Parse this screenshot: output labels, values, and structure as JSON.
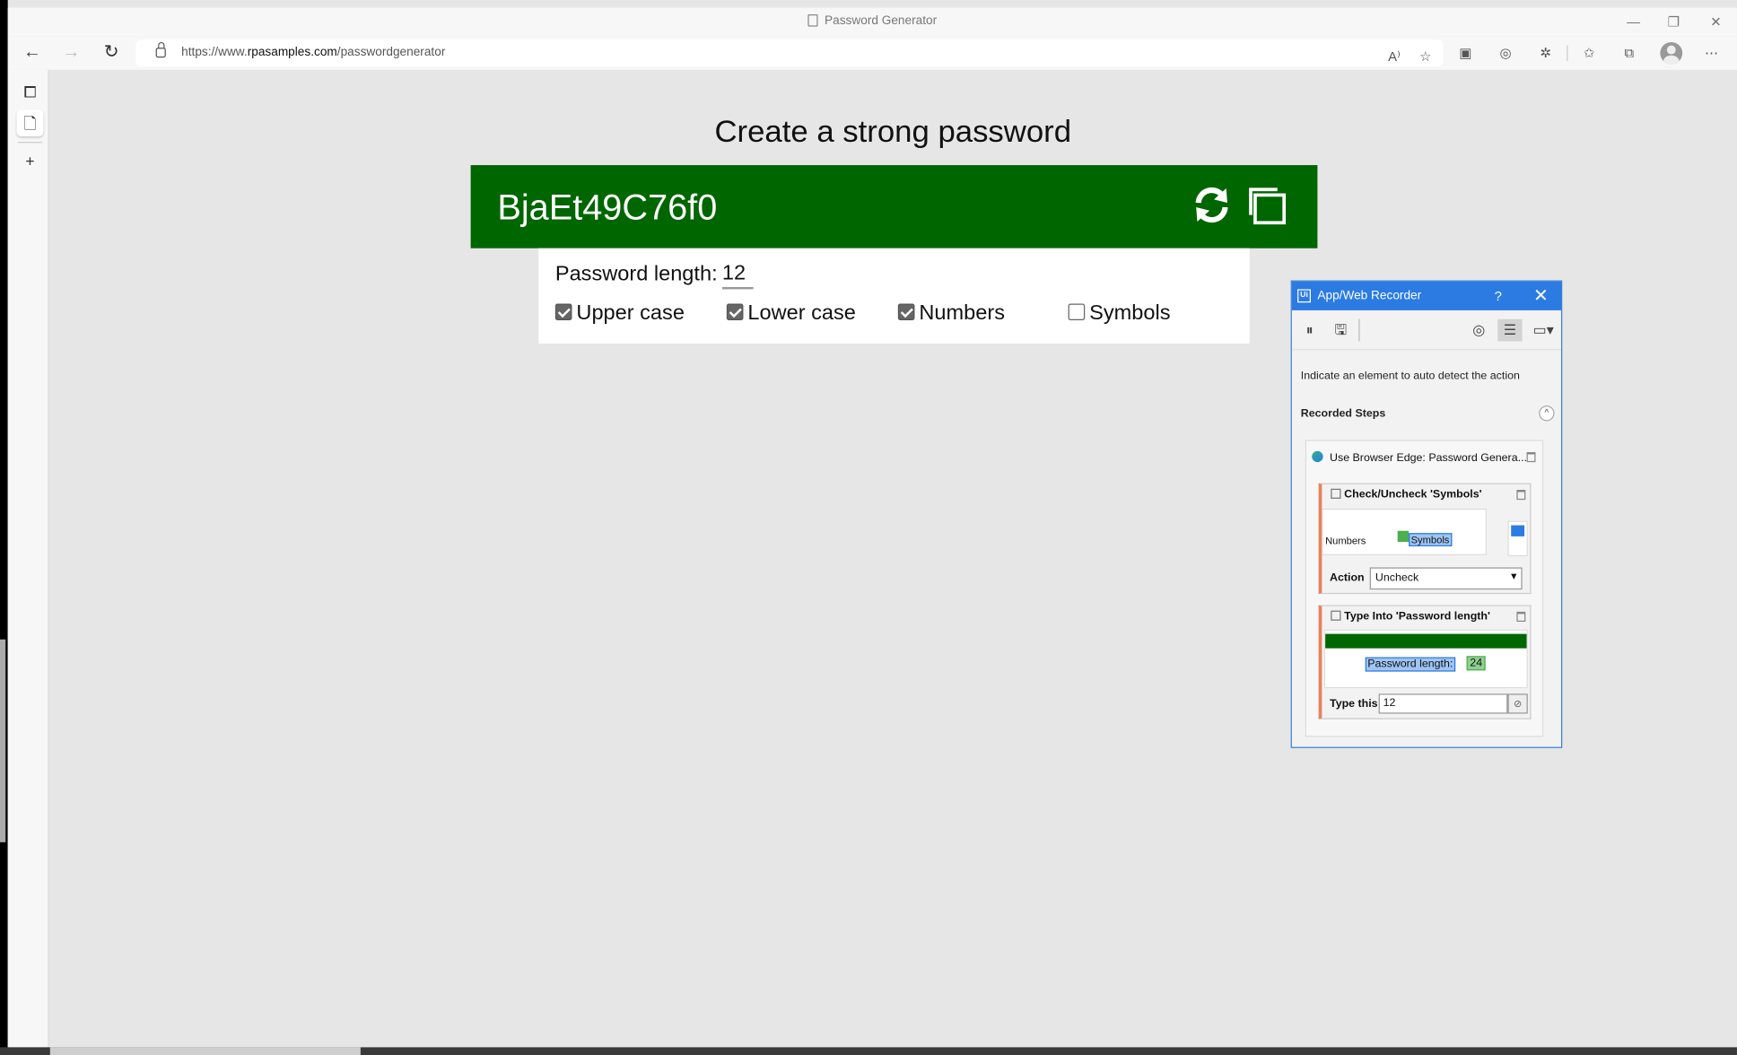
{
  "browser": {
    "tab_title": "Password Generator",
    "url_prefix": "https://www.",
    "url_domain": "rpasamples.com",
    "url_path": "/passwordgenerator"
  },
  "page": {
    "heading": "Create a strong password",
    "password": "BjaEt49C76f0",
    "length_label": "Password length:",
    "length_value": "12",
    "options": [
      {
        "label": "Upper case",
        "checked": true
      },
      {
        "label": "Lower case",
        "checked": true
      },
      {
        "label": "Numbers",
        "checked": true
      },
      {
        "label": "Symbols",
        "checked": false
      }
    ],
    "accent_color": "#006600"
  },
  "recorder": {
    "title": "App/Web Recorder",
    "help": "?",
    "hint": "Indicate an element to auto detect the action",
    "steps_header": "Recorded Steps",
    "scope_label": "Use Browser Edge: Password Genera...",
    "step1": {
      "title": "Check/Uncheck 'Symbols'",
      "thumb_left": "Numbers",
      "thumb_target": "Symbols",
      "action_label": "Action",
      "action_value": "Uncheck"
    },
    "step2": {
      "title": "Type Into 'Password length'",
      "thumb_target": "Password length:",
      "thumb_value": "24",
      "type_label": "Type this",
      "type_value": "12"
    },
    "accent_color": "#2b7be2"
  }
}
